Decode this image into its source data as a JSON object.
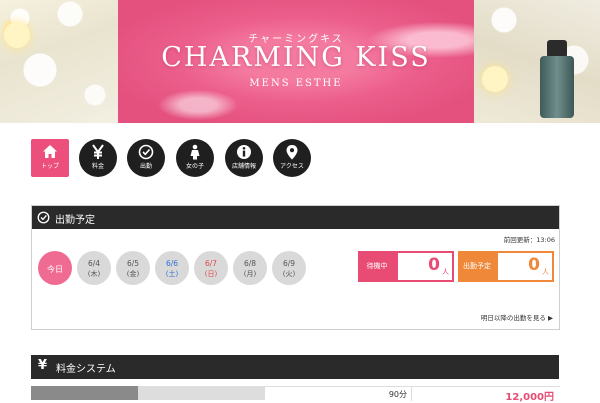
{
  "banner": {
    "subtitle": "チャーミングキス",
    "title": "CHARMING KISS",
    "tagline": "MENS ESTHE"
  },
  "nav": {
    "items": [
      {
        "label": "トップ",
        "icon": "home-icon"
      },
      {
        "label": "料金",
        "icon": "yen-icon"
      },
      {
        "label": "出勤",
        "icon": "clock-icon"
      },
      {
        "label": "女の子",
        "icon": "girl-icon"
      },
      {
        "label": "店舗情報",
        "icon": "info-icon"
      },
      {
        "label": "アクセス",
        "icon": "map-pin-icon"
      }
    ]
  },
  "schedule": {
    "title": "出勤予定",
    "updated": "前回更新：13:06",
    "today_label": "今日",
    "days": [
      {
        "date": "6/4",
        "weekday": "(木)"
      },
      {
        "date": "6/5",
        "weekday": "(金)"
      },
      {
        "date": "6/6",
        "weekday": "(土)"
      },
      {
        "date": "6/7",
        "weekday": "(日)"
      },
      {
        "date": "6/8",
        "weekday": "(月)"
      },
      {
        "date": "6/9",
        "weekday": "(火)"
      }
    ],
    "waiting": {
      "label": "待機中",
      "count": "0",
      "unit": "人"
    },
    "scheduled": {
      "label": "出勤予定",
      "count": "0",
      "unit": "人"
    },
    "more_link": "明日以降の出勤を見る ▶"
  },
  "pricing": {
    "title": "料金システム",
    "icon": "yen-icon",
    "rows": [
      {
        "duration": "90分",
        "price": "12,000円"
      }
    ]
  },
  "colors": {
    "accent_pink": "#ec4f7c",
    "accent_orange": "#f0883a",
    "header_dark": "#2a2a2a",
    "saturday_blue": "#2f6fd6",
    "sunday_red": "#e04848"
  }
}
